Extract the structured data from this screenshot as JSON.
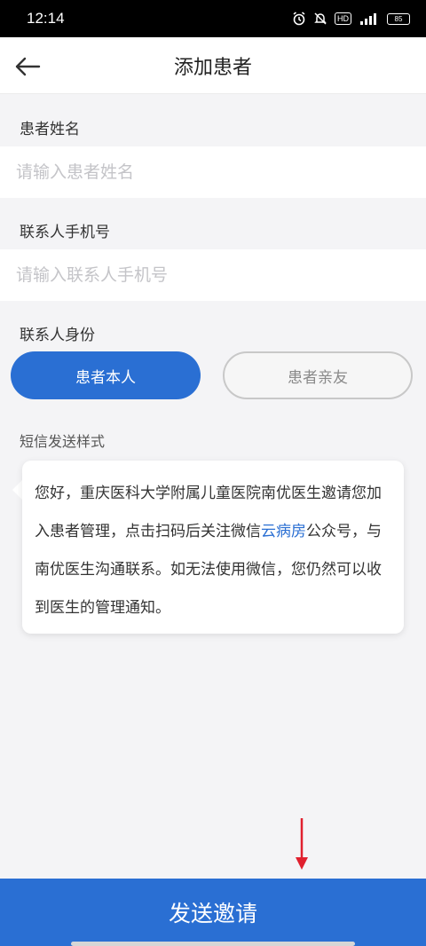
{
  "status_bar": {
    "time": "12:14",
    "hd": "HD",
    "battery": "85"
  },
  "header": {
    "title": "添加患者",
    "back_icon": "arrow-left-icon"
  },
  "form": {
    "patient_name": {
      "label": "患者姓名",
      "placeholder": "请输入患者姓名",
      "value": ""
    },
    "contact_phone": {
      "label": "联系人手机号",
      "placeholder": "请输入联系人手机号",
      "value": ""
    },
    "contact_identity": {
      "label": "联系人身份",
      "options": [
        "患者本人",
        "患者亲友"
      ],
      "selected": "患者本人"
    }
  },
  "sms": {
    "label": "短信发送样式",
    "text_before_link": "您好，重庆医科大学附属儿童医院南优医生邀请您加入患者管理，点击扫码后关注微信",
    "link_text": "云病房",
    "text_after_link": "公众号，与南优医生沟通联系。如无法使用微信，您仍然可以收到医生的管理通知。"
  },
  "actions": {
    "send_label": "发送邀请"
  },
  "colors": {
    "primary": "#2a6fd3",
    "background": "#f4f4f6",
    "annotation_arrow": "#e0202e"
  }
}
